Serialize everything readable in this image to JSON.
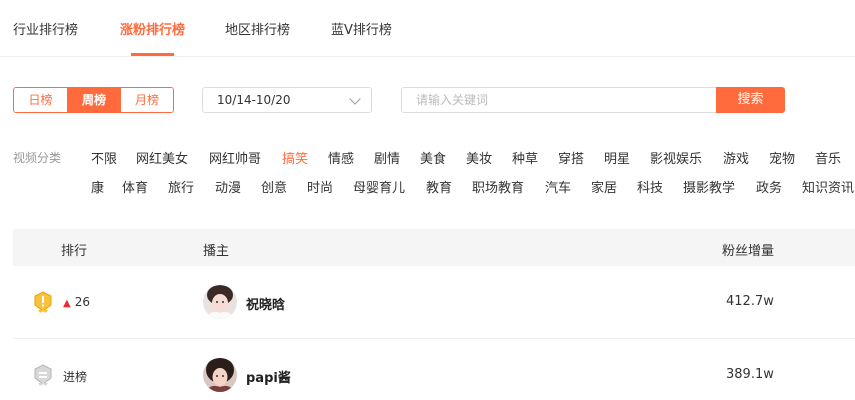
{
  "tabs": [
    {
      "label": "行业排行榜"
    },
    {
      "label": "涨粉排行榜",
      "active": true
    },
    {
      "label": "地区排行榜"
    },
    {
      "label": "蓝V排行榜"
    }
  ],
  "accent_color": "#ff6b3d",
  "period": {
    "options": [
      "日榜",
      "周榜",
      "月榜"
    ],
    "selected": "周榜"
  },
  "date_range": {
    "value": "10/14-10/20",
    "icon": "chevron-down-icon"
  },
  "search": {
    "placeholder": "请输入关键词",
    "button_label": "搜索"
  },
  "categories": {
    "label": "视频分类",
    "selected": "搞笑",
    "row1": [
      "不限",
      "网红美女",
      "网红帅哥",
      "搞笑",
      "情感",
      "剧情",
      "美食",
      "美妆",
      "种草",
      "穿搭",
      "明星",
      "影视娱乐",
      "游戏",
      "宠物",
      "音乐"
    ],
    "row2": [
      "康",
      "体育",
      "旅行",
      "动漫",
      "创意",
      "时尚",
      "母婴育儿",
      "教育",
      "职场教育",
      "汽车",
      "家居",
      "科技",
      "摄影教学",
      "政务",
      "知识资讯"
    ]
  },
  "table": {
    "headers": {
      "rank": "排行",
      "host": "播主",
      "fans": "粉丝增量"
    },
    "rows": [
      {
        "rank_icon": "gold-medal-icon",
        "rank_change": "26",
        "rank_trend": "up",
        "name": "祝晓晗",
        "fans_increase": "412.7w"
      },
      {
        "rank_icon": "silver-medal-icon",
        "rank_change": "进榜",
        "rank_trend": "new",
        "name": "papi酱",
        "fans_increase": "389.1w"
      }
    ]
  }
}
